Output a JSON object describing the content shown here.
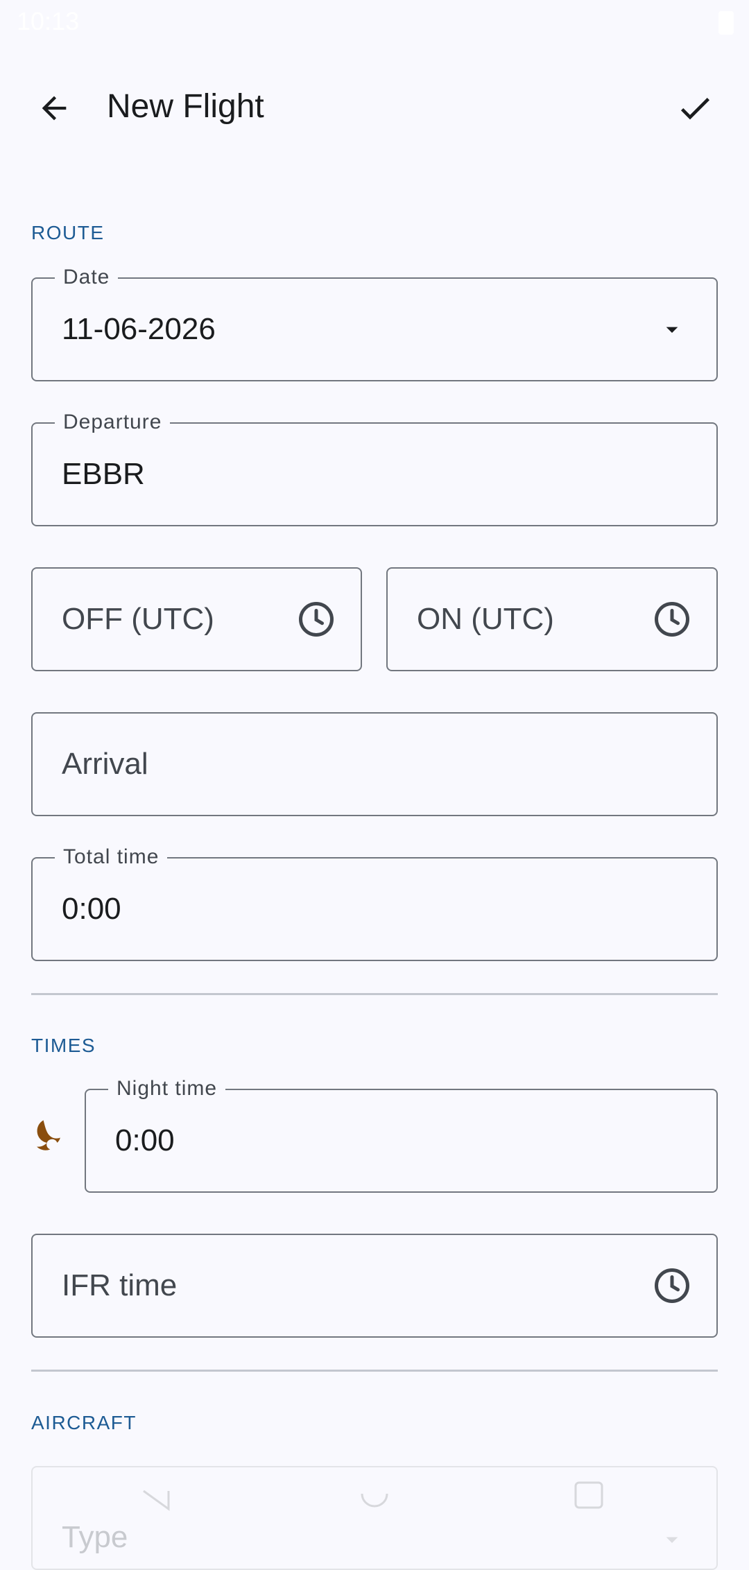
{
  "status_bar": {
    "time": "10:13"
  },
  "app_bar": {
    "title": "New Flight"
  },
  "sections": {
    "route": "ROUTE",
    "times": "TIMES",
    "aircraft": "AIRCRAFT"
  },
  "route": {
    "date": {
      "label": "Date",
      "value": "11-06-2026"
    },
    "departure": {
      "label": "Departure",
      "value": "EBBR"
    },
    "off_time": {
      "placeholder": "OFF (UTC)"
    },
    "on_time": {
      "placeholder": "ON (UTC)"
    },
    "arrival": {
      "placeholder": "Arrival"
    },
    "total_time": {
      "label": "Total time",
      "value": "0:00"
    }
  },
  "times": {
    "night_time": {
      "label": "Night time",
      "value": "0:00"
    },
    "ifr_time": {
      "placeholder": "IFR time"
    }
  },
  "aircraft": {
    "type": {
      "placeholder": "Type"
    }
  },
  "colors": {
    "accent": "#1d5b94",
    "night_icon": "#8a4e0e",
    "outline": "#72777f",
    "background": "#f9f9fe"
  },
  "icons": [
    "arrow-back-icon",
    "check-icon",
    "dropdown-arrow-icon",
    "clock-icon",
    "moon-icon"
  ]
}
